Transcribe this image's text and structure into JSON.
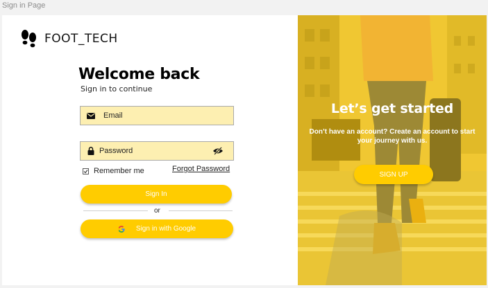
{
  "window": {
    "title": "Sign in Page"
  },
  "brand": {
    "name": "FOOT_TECH",
    "icon": "footprints-icon"
  },
  "login": {
    "heading": "Welcome back",
    "subheading": "Sign in to continue",
    "email_placeholder": "Email",
    "password_placeholder": "Password",
    "remember_label": "Remember me",
    "forgot_label": "Forgot Password",
    "signin_label": "Sign In",
    "or_label": "or",
    "google_label": "Sign in with Google"
  },
  "promo": {
    "title": "Let’s get started",
    "subtitle": "Don’t have an account? Create an account to start your journey with us.",
    "signup_label": "SIGN UP"
  },
  "colors": {
    "accent": "#ffcc00",
    "field_bg": "#fdefb1",
    "text": "#222222"
  }
}
